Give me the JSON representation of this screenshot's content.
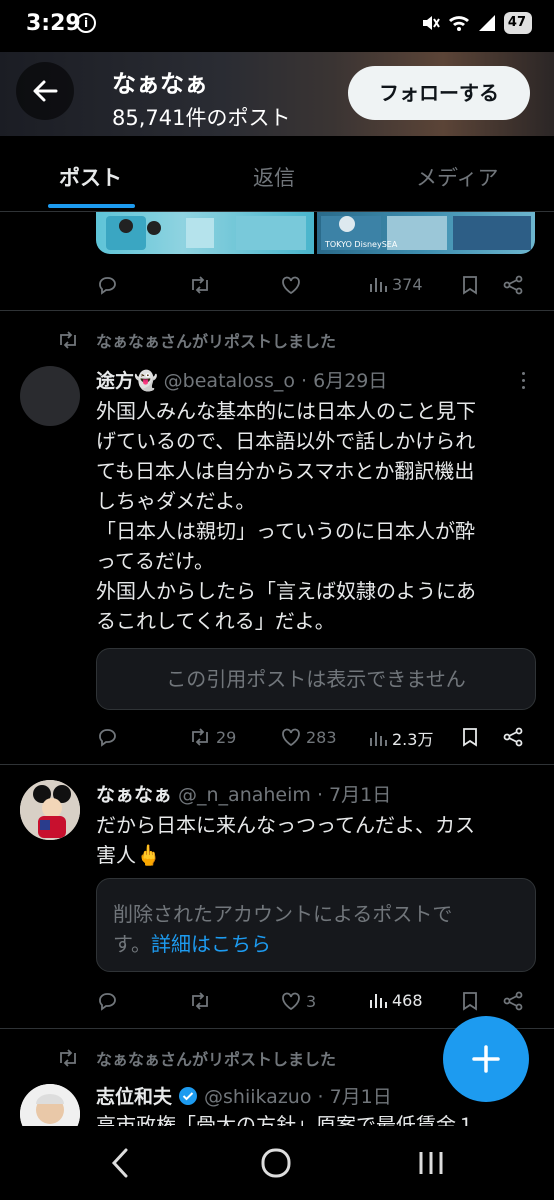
{
  "status": {
    "time": "3:29",
    "battery": "47"
  },
  "header": {
    "name": "なぁなぁ",
    "post_count": "85,741件のポスト",
    "follow_label": "フォローする"
  },
  "tabs": [
    {
      "label": "ポスト"
    },
    {
      "label": "返信"
    },
    {
      "label": "メディア"
    }
  ],
  "post1": {
    "media_a_text": "",
    "media_b_text": "TOKYO DisneySEA",
    "views": "374"
  },
  "post2": {
    "repost_note": "なぁなぁさんがリポストしました",
    "display_name": "途方👻",
    "handle_date": "@beataloss_o · 6月29日",
    "lines": [
      "外国人みんな基本的には日本人のこと見下",
      "げているので、日本語以外で話しかけられ",
      "ても日本人は自分からスマホとか翻訳機出",
      "しちゃダメだよ。",
      "「日本人は親切」っていうのに日本人が酔",
      "ってるだけ。",
      "外国人からしたら「言えば奴隷のようにあ",
      "るこれしてくれる」だよ。"
    ],
    "quote_unavailable": "この引用ポストは表示できません",
    "retweets": "29",
    "likes": "283",
    "views": "2.3万"
  },
  "post3": {
    "display_name": "なぁなぁ",
    "handle_date": "@_n_anaheim · 7月1日",
    "lines": [
      "だから日本に来んなっつってんだよ、カス",
      "害人🖕"
    ],
    "quote_line1": "削除されたアカウントによるポストで",
    "quote_line2_prefix": "す。",
    "quote_link": "詳細はこちら",
    "likes": "3",
    "views": "468"
  },
  "post4": {
    "repost_note": "なぁなぁさんがリポストしました",
    "display_name": "志位和夫",
    "handle_date": "@shiikazuo · 7月1日",
    "partial_line": "高市政権「骨太の方針」原案で最低賃金１"
  },
  "colors": {
    "accent": "#1d9bf0",
    "background": "#000000",
    "muted": "#71767b"
  }
}
